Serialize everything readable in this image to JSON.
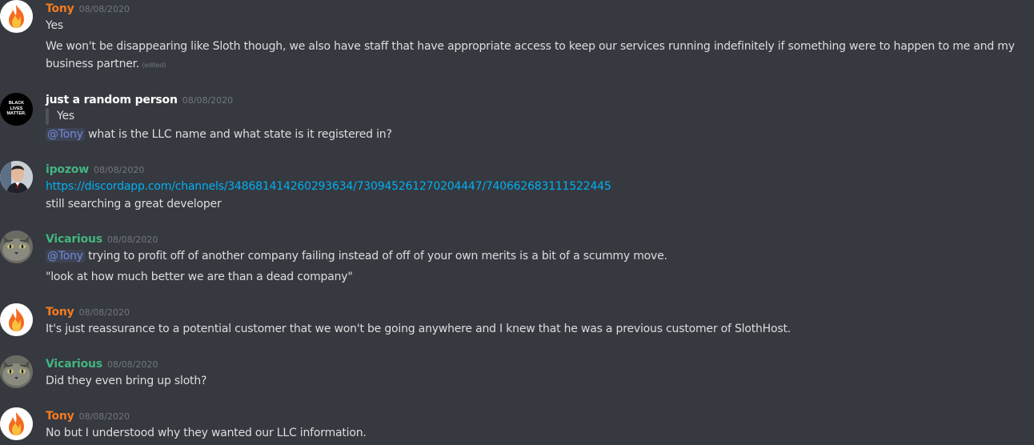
{
  "colors": {
    "background": "#36393f",
    "tony": "#f47b1f",
    "regular": "#ffffff",
    "green": "#43b581",
    "timestamp": "#72767d",
    "text": "#dcddde",
    "link": "#00b0f4",
    "mention": "#7289da"
  },
  "messages": [
    {
      "author": "Tony",
      "timestamp": "08/08/2020",
      "lines": [
        "Yes",
        "We won't be disappearing like Sloth though, we also have staff that have appropriate access to keep our services running indefinitely if something were to happen to me and my business partner."
      ],
      "edited": "(edited)",
      "avatar": "flame-icon"
    },
    {
      "author": "just a random person",
      "timestamp": "08/08/2020",
      "avatar_text": "BLACK LIVES MATTER.",
      "quote": "Yes",
      "mention": "@Tony",
      "text": "what is the LLC name and what state is it registered in?"
    },
    {
      "author": "ipozow",
      "timestamp": "08/08/2020",
      "avatar": "person-photo",
      "link": "https://discordapp.com/channels/348681414260293634/730945261270204447/740662683111522445",
      "text": "still searching a great developer"
    },
    {
      "author": "Vicarious",
      "timestamp": "08/08/2020",
      "avatar": "cat-icon",
      "mention": "@Tony",
      "text": "trying to profit off of another company failing instead of off of your own merits is a bit of a scummy move.",
      "text2": "\"look at how much better we are than a dead company\""
    },
    {
      "author": "Tony",
      "timestamp": "08/08/2020",
      "avatar": "flame-icon",
      "text": "It's just reassurance to a potential customer that we won't be going anywhere and I knew that he was a previous customer of SlothHost."
    },
    {
      "author": "Vicarious",
      "timestamp": "08/08/2020",
      "avatar": "cat-icon",
      "text": "Did they even bring up sloth?"
    },
    {
      "author": "Tony",
      "timestamp": "08/08/2020",
      "avatar": "flame-icon",
      "text": "No but I understood why they wanted our LLC information."
    }
  ]
}
